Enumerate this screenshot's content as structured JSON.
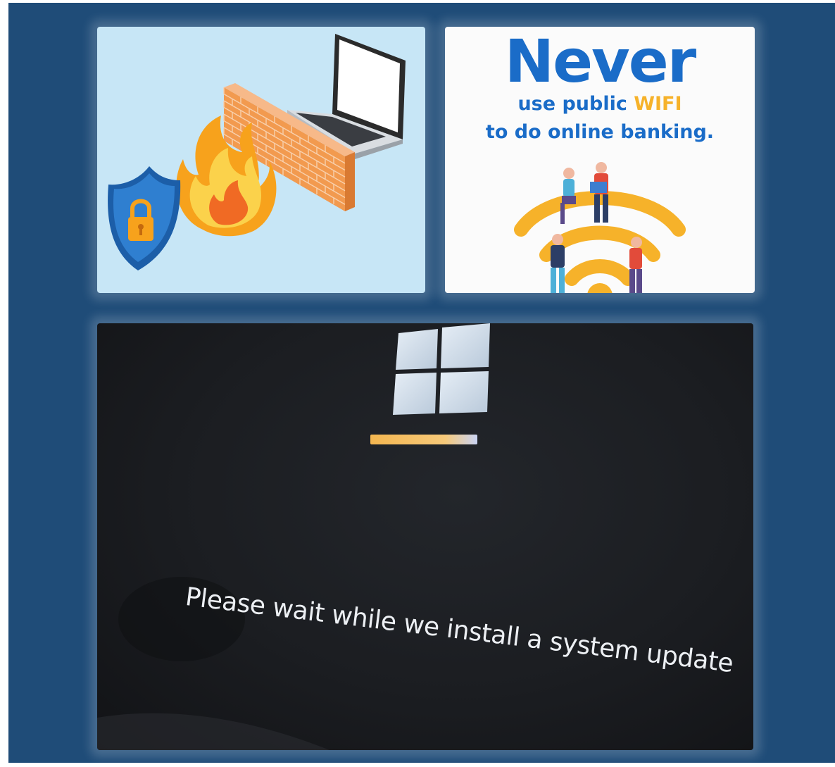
{
  "security_tip": {
    "headline": "Never",
    "line1_prefix": "use public ",
    "line1_highlight": "WIFI",
    "line2": "to do online banking."
  },
  "update_screen": {
    "message": "Please wait while we install a system update",
    "progress": 1.0
  },
  "colors": {
    "background": "#1f4c78",
    "brand_blue": "#1a6cc8",
    "accent_orange": "#f6b22a",
    "firewall_bg": "#c7e6f6"
  },
  "icons": [
    "shield-lock-icon",
    "flame-icon",
    "brick-wall-icon",
    "laptop-icon",
    "wifi-icon",
    "windows-logo-icon"
  ]
}
